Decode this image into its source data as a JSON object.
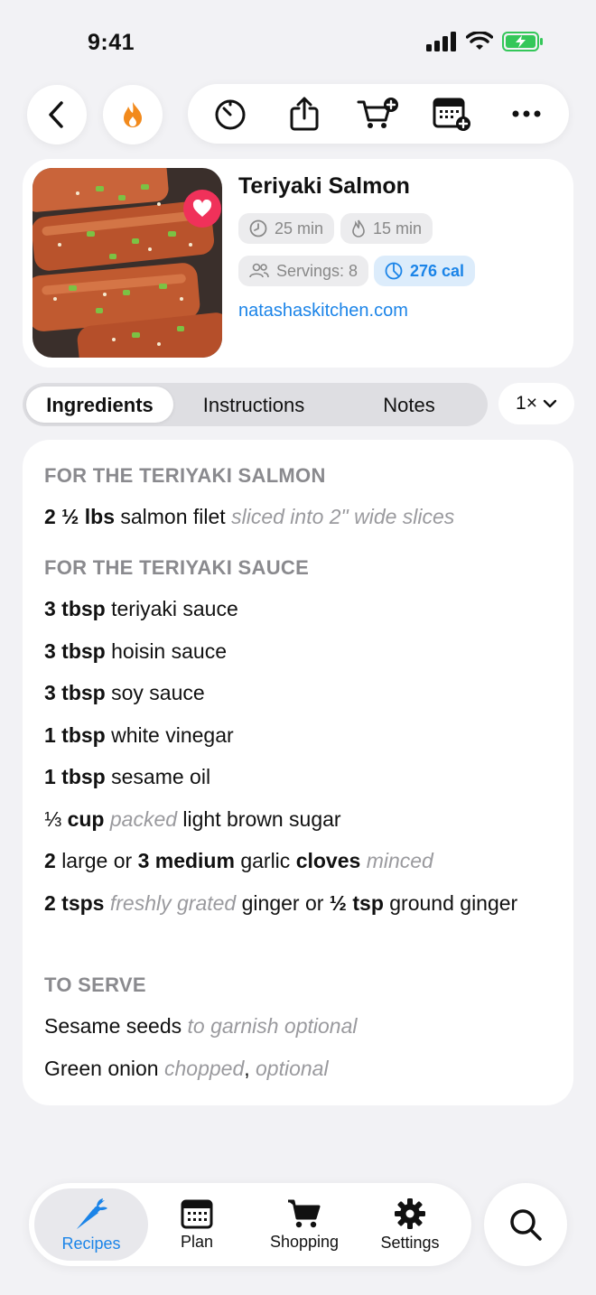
{
  "status": {
    "time": "9:41"
  },
  "recipe": {
    "title": "Teriyaki Salmon",
    "prep_time": "25 min",
    "cook_time": "15 min",
    "servings": "Servings: 8",
    "calories": "276 cal",
    "source": "natashaskitchen.com"
  },
  "tabs": {
    "ingredients": "Ingredients",
    "instructions": "Instructions",
    "notes": "Notes",
    "active": "Ingredients"
  },
  "scale": {
    "label": "1×"
  },
  "sections": [
    {
      "heading": "FOR THE TERIYAKI SALMON"
    },
    {
      "heading": "FOR THE TERIYAKI SAUCE"
    },
    {
      "heading": "TO SERVE"
    }
  ],
  "ingredients": {
    "salmon_qty": "2 ½ lbs",
    "salmon_name": "salmon filet",
    "salmon_note": "sliced into 2\" wide slices",
    "teriyaki_qty": "3 tbsp",
    "teriyaki_name": "teriyaki sauce",
    "hoisin_qty": "3 tbsp",
    "hoisin_name": "hoisin sauce",
    "soy_qty": "3 tbsp",
    "soy_name": "soy sauce",
    "vinegar_qty": "1 tbsp",
    "vinegar_name": "white vinegar",
    "sesame_oil_qty": "1 tbsp",
    "sesame_oil_name": "sesame oil",
    "sugar_qty_num": "⅓",
    "sugar_qty_unit": "cup",
    "sugar_note": "packed",
    "sugar_name": "light brown sugar",
    "garlic_a": "2",
    "garlic_b": "large or",
    "garlic_c": "3 medium",
    "garlic_d": "garlic",
    "garlic_e": "cloves",
    "garlic_note": "minced",
    "ginger_a": "2 tsps",
    "ginger_note": "freshly grated",
    "ginger_b": "ginger or",
    "ginger_c": "½ tsp",
    "ginger_d": "ground",
    "ginger_e": "ginger",
    "sesame_seeds_name": "Sesame seeds",
    "sesame_seeds_note": "to garnish optional",
    "green_onion_name": "Green onion",
    "green_onion_note1": "chopped",
    "green_onion_sep": ",",
    "green_onion_note2": "optional"
  },
  "tabbar": {
    "recipes": "Recipes",
    "plan": "Plan",
    "shopping": "Shopping",
    "settings": "Settings"
  },
  "colors": {
    "accent": "#1b84e8",
    "favorite": "#f0315a",
    "flame": "#f28a1c",
    "battery": "#34c759"
  },
  "icons": [
    "back-icon",
    "flame-icon",
    "timer-icon",
    "share-icon",
    "cart-add-icon",
    "calendar-add-icon",
    "more-icon",
    "heart-icon",
    "clock-icon",
    "fire-icon",
    "people-icon",
    "pie-icon",
    "chevron-down-icon",
    "carrot-icon",
    "calendar-icon",
    "cart-icon",
    "gear-icon",
    "search-icon"
  ]
}
